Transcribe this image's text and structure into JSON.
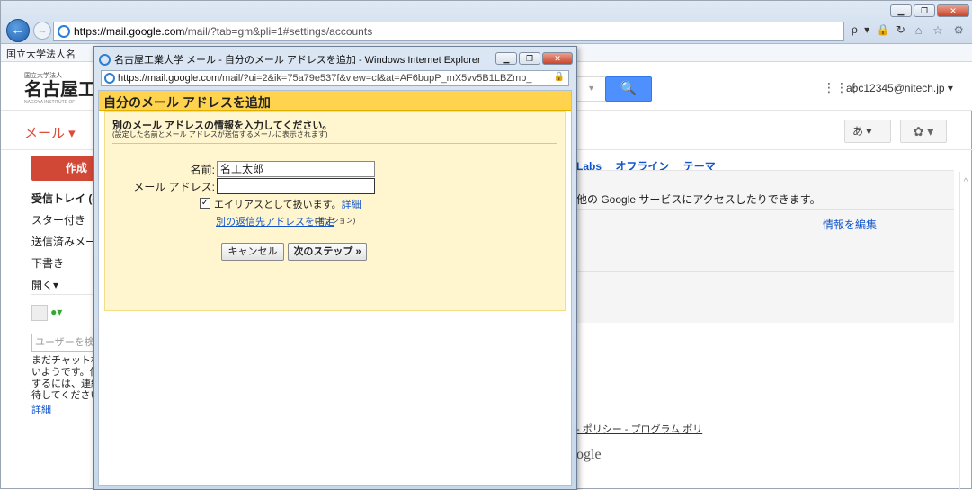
{
  "browser": {
    "url_host": "https://mail.google.com",
    "url_rest": "/mail/?tab=gm&pli=1#settings/accounts",
    "addr_tools": "ρ ▾ 🔒 ↻",
    "ie_tools": "⌂ ☆ ⚙",
    "favorites_item": "国立大学法人名"
  },
  "gmail": {
    "logo_small": "国立大学法人",
    "logo_big": "名古屋工",
    "logo_tiny": "NAGOYA INSTITUTE OF",
    "search_stub": "▾",
    "search_icon": "🔍",
    "apps_icon": "⋮⋮⋮",
    "account": "abc12345@nitech.jp ▾",
    "mail_label": "メール ▾",
    "ime_label": "あ ▾",
    "gear_label": "✿ ▾",
    "compose": "作成",
    "nav": [
      "受信トレイ (4)",
      "スター付き",
      "送信済みメー",
      "下書き",
      "開く▾"
    ],
    "chat_status": "●▾",
    "user_search_placeholder": "ユーザーを検",
    "chat_message": "まだチャット相いようです。使するには、連絡待してください",
    "chat_link": "詳細",
    "settings_tabs": [
      "Labs",
      "オフライン",
      "テーマ"
    ],
    "content_line": "他の Google サービスにアクセスしたりできます。",
    "edit_info": "情報を編集",
    "footer_links": "- ポリシー - プログラム ポリ",
    "footer_logo": "ogle"
  },
  "popup": {
    "window_title": "名古屋工業大学 メール - 自分のメール アドレスを追加 - Windows Internet Explorer",
    "url_host": "https://mail.google.com",
    "url_rest": "/mail/?ui=2&ik=75a79e537f&view=cf&at=AF6bupP_mX5vv5B1LBZmb_",
    "lock": "🔒",
    "heading": "自分のメール アドレスを追加",
    "subheading": "別のメール アドレスの情報を入力してください。",
    "note": "(設定した名前とメール アドレスが送信するメールに表示されます)",
    "name_label": "名前:",
    "name_value": "名工太郎",
    "email_label": "メール アドレス:",
    "email_value": "",
    "alias_checkbox": "✓",
    "alias_label": "エイリアスとして扱います。",
    "alias_detail": "詳細",
    "reply_link": "別の返信先アドレスを指定",
    "reply_optional": "(オプション)",
    "cancel_button": "キャンセル",
    "next_button": "次のステップ »"
  }
}
